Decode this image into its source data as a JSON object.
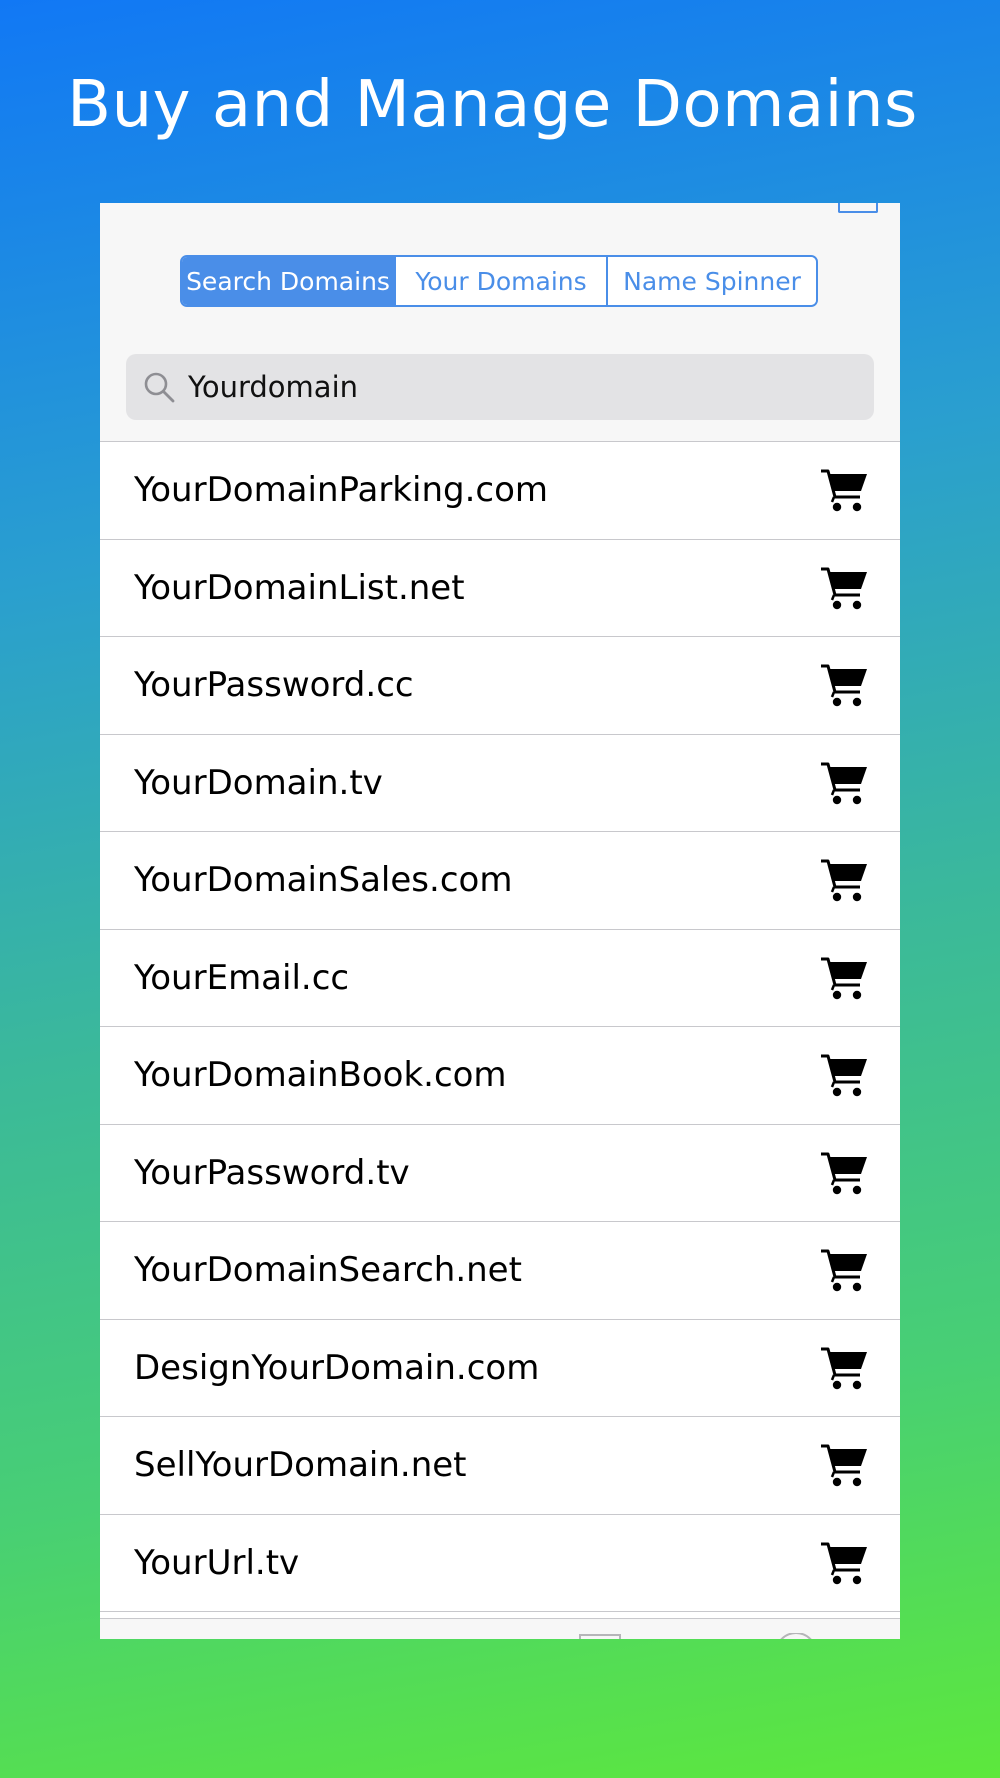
{
  "headline": "Buy and Manage Domains",
  "segmented": {
    "options": [
      "Search Domains",
      "Your Domains",
      "Name Spinner"
    ],
    "selected": "Search Domains"
  },
  "search": {
    "value": "Yourdomain",
    "icon": "search-icon"
  },
  "results": [
    "YourDomainParking.com",
    "YourDomainList.net",
    "YourPassword.cc",
    "YourDomain.tv",
    "YourDomainSales.com",
    "YourEmail.cc",
    "YourDomainBook.com",
    "YourPassword.tv",
    "YourDomainSearch.net",
    "DesignYourDomain.com",
    "SellYourDomain.net",
    "YourUrl.tv"
  ],
  "row_icon": "cart-icon",
  "colors": {
    "accent": "#4a8ee8",
    "gradient_top": "#1178f5",
    "gradient_bottom": "#5de83c"
  }
}
